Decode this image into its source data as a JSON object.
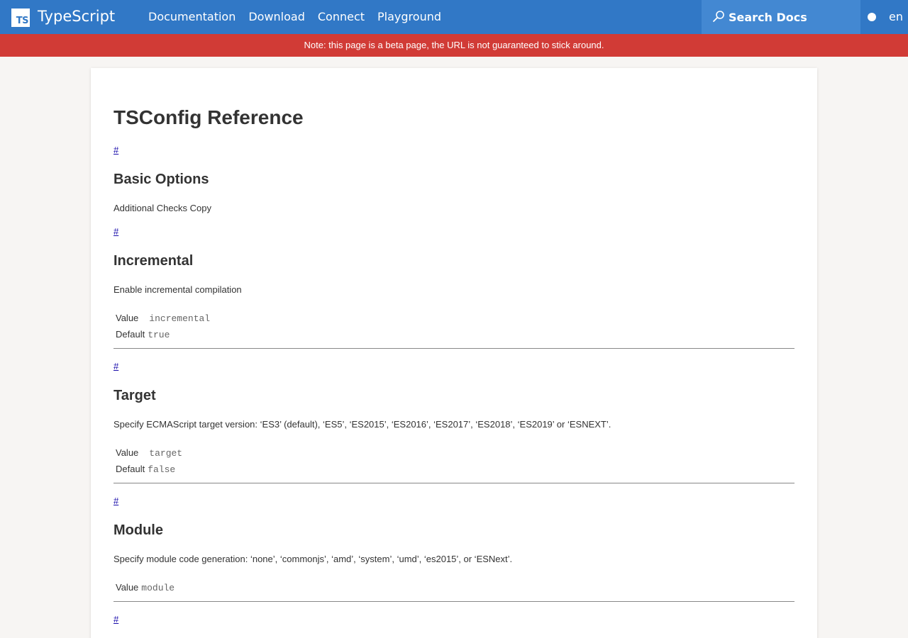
{
  "header": {
    "logo_text": "TS",
    "brand": "TypeScript",
    "nav": [
      "Documentation",
      "Download",
      "Connect",
      "Playground"
    ],
    "search_placeholder": "Search Docs",
    "lang": "en",
    "bg_color": "#3178c6"
  },
  "banner": {
    "text": "Note: this page is a beta page, the URL is not guaranteed to stick around.",
    "bg_color": "#d13b36"
  },
  "page": {
    "title": "TSConfig Reference",
    "anchor": "#",
    "sections": [
      {
        "title": "Basic Options",
        "desc": "Additional Checks Copy"
      },
      {
        "title": "Incremental",
        "desc": "Enable incremental compilation",
        "value_label": "Value",
        "value": "incremental",
        "default_label": "Default",
        "default": "true"
      },
      {
        "title": "Target",
        "desc": "Specify ECMAScript target version: ‘ES3’ (default), ‘ES5’, ‘ES2015’, ‘ES2016’, ‘ES2017’, ‘ES2018’, ‘ES2019’ or ‘ESNEXT’.",
        "value_label": "Value",
        "value": "target",
        "default_label": "Default",
        "default": "false"
      },
      {
        "title": "Module",
        "desc": "Specify module code generation: ‘none’, ‘commonjs’, ‘amd’, ‘system’, ‘umd’, ‘es2015’, or ‘ESNext’.",
        "value_label": "Value",
        "value": "module"
      }
    ]
  }
}
